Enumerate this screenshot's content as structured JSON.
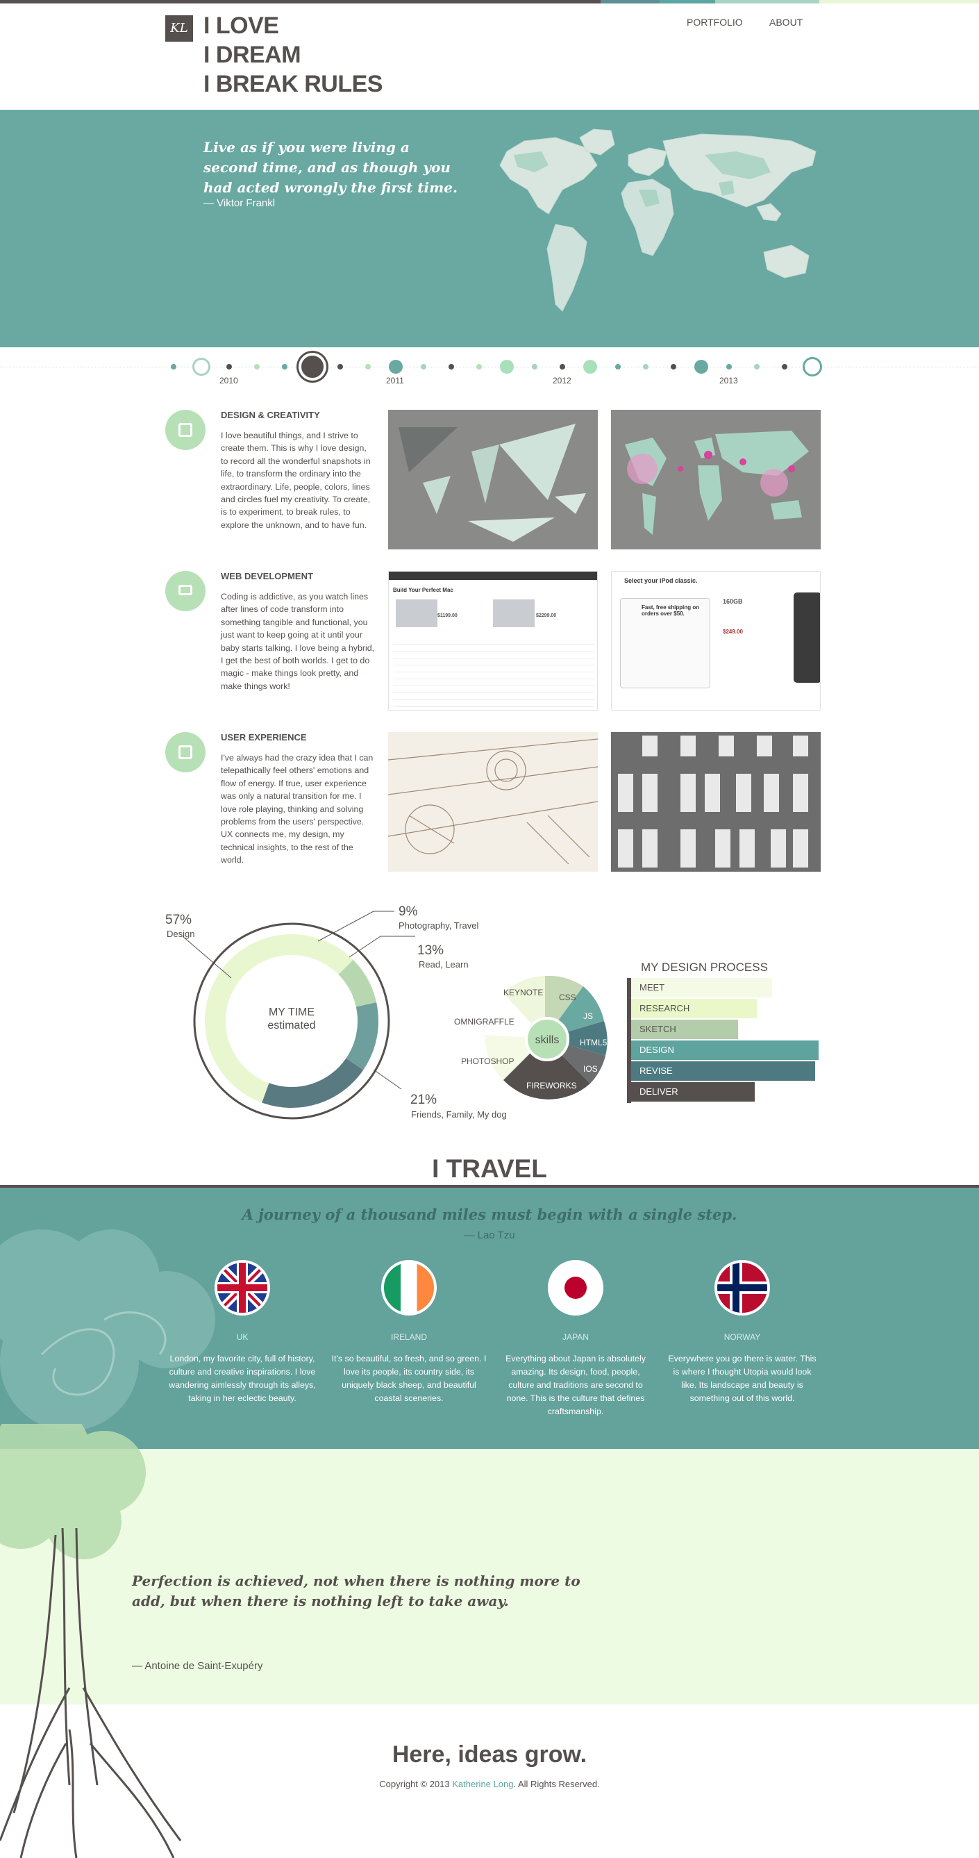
{
  "header": {
    "logo": "KL",
    "headline": [
      "I LOVE",
      "I DREAM",
      "I BREAK RULES"
    ],
    "nav": [
      "PORTFOLIO",
      "ABOUT"
    ]
  },
  "hero": {
    "quote": "Live as if you were living a second time, and as though you had acted wrongly the first time.",
    "author": "— Viktor Frankl"
  },
  "timeline": {
    "years": [
      "2010",
      "2011",
      "2012",
      "2013"
    ]
  },
  "categories": [
    {
      "title": "DESIGN & CREATIVITY",
      "icon": "design-icon",
      "body": "I love beautiful things, and I strive to create them. This is why I love design, to record all the wonderful snapshots in life, to transform the ordinary into the extraordinary. Life, people, colors, lines and circles fuel my creativity. To create, is to experiment, to break rules, to explore the unknown, and to have fun."
    },
    {
      "title": "WEB DEVELOPMENT",
      "icon": "monitor-icon",
      "body": "Coding is addictive, as you watch lines after lines of code transform into something tangible and functional, you just want to keep going at it until your baby starts talking. I love being a hybrid, I get the best of both worlds. I get to do magic - make things look pretty, and make things work!"
    },
    {
      "title": "USER EXPERIENCE",
      "icon": "wireframe-icon",
      "body": "I've always had the crazy idea that I can telepathically feel others' emotions and flow of energy. If true, user experience was only a natural transition for me. I love role playing, thinking and solving problems from the users' perspective. UX connects me, my design, my technical insights, to the rest of the world."
    }
  ],
  "thumbnails": {
    "apple_title": "Build Your Perfect Mac",
    "apple_price_1": "$1199.00",
    "apple_price_2": "$2299.00",
    "ipod_title": "Select your iPod classic.",
    "ipod_shipping": "Fast, free shipping on orders over $50.",
    "ipod_capacity": "160GB",
    "ipod_price": "$249.00"
  },
  "time_chart": {
    "center_title": "MY TIME",
    "center_sub": "estimated",
    "segments": [
      {
        "percent": "57%",
        "label": "Design",
        "value": 57,
        "color": "#e9f7d0"
      },
      {
        "percent": "9%",
        "label": "Photography, Travel",
        "value": 9,
        "color": "#b7d7b0"
      },
      {
        "percent": "13%",
        "label": "Read, Learn",
        "value": 13,
        "color": "#6e9f9c"
      },
      {
        "percent": "21%",
        "label": "Friends, Family, My dog",
        "value": 21,
        "color": "#587a80"
      }
    ]
  },
  "skills_chart": {
    "center": "skills",
    "items": [
      "KEYNOTE",
      "OMNIGRAFFLE",
      "PHOTOSHOP",
      "CSS",
      "JS",
      "HTML5",
      "IOS",
      "FIREWORKS"
    ]
  },
  "design_process": {
    "title": "MY DESIGN PROCESS",
    "steps": [
      {
        "label": "MEET",
        "value": 0.75,
        "color": "#f4fae6",
        "text": "#55504e"
      },
      {
        "label": "RESEARCH",
        "value": 0.67,
        "color": "#e9f7c9",
        "text": "#55504e"
      },
      {
        "label": "SKETCH",
        "value": 0.57,
        "color": "#b3cdaa",
        "text": "#55504e"
      },
      {
        "label": "DESIGN",
        "value": 1.0,
        "color": "#5fa39e",
        "text": "#ffffff"
      },
      {
        "label": "REVISE",
        "value": 0.98,
        "color": "#4d7a80",
        "text": "#ffffff"
      },
      {
        "label": "DELIVER",
        "value": 0.66,
        "color": "#55504e",
        "text": "#ffffff"
      }
    ]
  },
  "travel": {
    "title": "I TRAVEL",
    "quote": "A journey of a thousand miles must begin with a single step.",
    "author": "— Lao Tzu",
    "countries": [
      {
        "name": "UK",
        "flag": "uk-flag-icon",
        "text": "London, my favorite city, full of history, culture and creative inspirations. I love wandering aimlessly through its alleys, taking in her eclectic beauty."
      },
      {
        "name": "IRELAND",
        "flag": "ireland-flag-icon",
        "text": "It's so beautiful, so fresh, and so green. I love its people, its country side, its uniquely black sheep, and beautiful coastal sceneries."
      },
      {
        "name": "JAPAN",
        "flag": "japan-flag-icon",
        "text": "Everything about Japan is absolutely amazing. Its design, food, people, culture and traditions are second to none. This is the culture that defines craftsmanship."
      },
      {
        "name": "NORWAY",
        "flag": "norway-flag-icon",
        "text": "Everywhere you go there is water. This is where I thought Utopia would look like. Its landscape and beauty is something out of this world."
      }
    ]
  },
  "lower": {
    "quote": "Perfection is achieved, not when there is nothing more to add, but when there is nothing left to take away.",
    "author": "— Antoine de Saint-Exupéry"
  },
  "footer": {
    "tagline": "Here, ideas grow.",
    "copy_prefix": "Copyright © 2013 ",
    "copy_name": "Katherine Long",
    "copy_suffix": ". All Rights Reserved."
  },
  "colors": {
    "teal": "#6aa8a2",
    "dark": "#55504e",
    "mint": "#b7e0b6",
    "light_green": "#eefbe3"
  }
}
